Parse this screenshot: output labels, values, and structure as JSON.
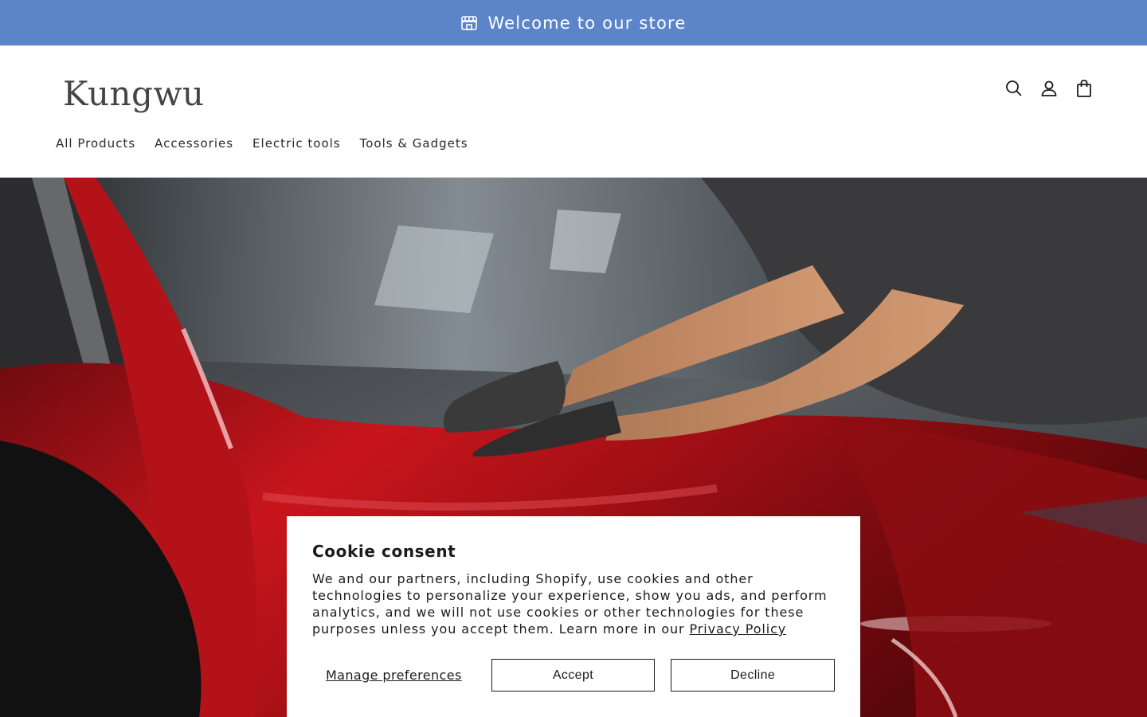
{
  "announcement": {
    "icon": "store-icon",
    "text": "Welcome to our store",
    "background": "#5b84c9"
  },
  "header": {
    "logo": "Kungwu",
    "icons": [
      "search-icon",
      "account-icon",
      "cart-icon"
    ]
  },
  "nav": {
    "items": [
      {
        "label": "All Products"
      },
      {
        "label": "Accessories"
      },
      {
        "label": "Electric tools"
      },
      {
        "label": "Tools & Gadgets"
      }
    ]
  },
  "hero": {
    "image": "Person in black gloves polishing a red car"
  },
  "cookie": {
    "title": "Cookie consent",
    "body": "We and our partners, including Shopify, use cookies and other technologies to personalize your experience, show you ads, and perform analytics, and we will not use cookies or other technologies for these purposes unless you accept them. Learn more in our ",
    "link_label": "Privacy Policy",
    "manage_label": "Manage preferences",
    "accept_label": "Accept",
    "decline_label": "Decline"
  }
}
